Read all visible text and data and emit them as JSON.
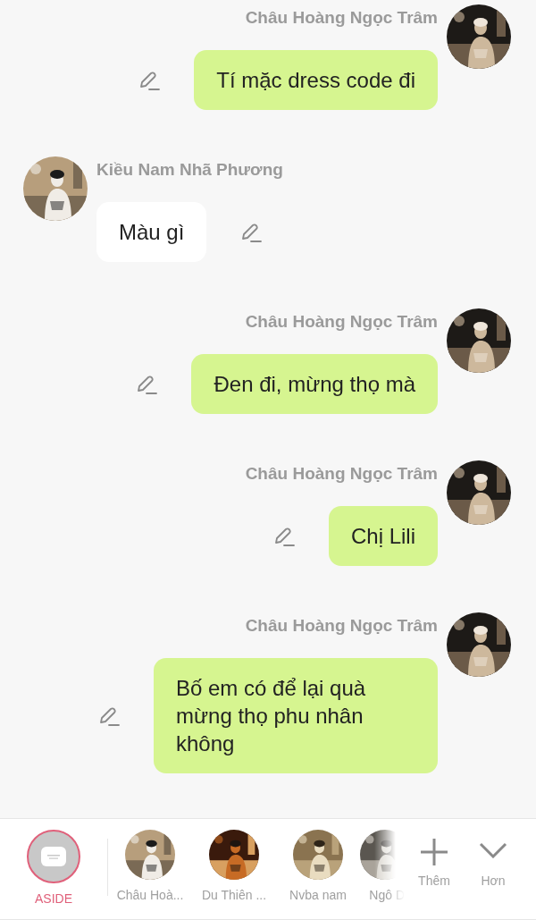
{
  "messages": [
    {
      "outgoing": true,
      "sender": "Châu Hoàng Ngọc Trâm",
      "text": "Tí mặc dress code đi"
    },
    {
      "outgoing": false,
      "sender": "Kiều Nam Nhã Phương",
      "text": "Màu gì"
    },
    {
      "outgoing": true,
      "sender": "Châu Hoàng Ngọc Trâm",
      "text": "Đen đi, mừng thọ mà"
    },
    {
      "outgoing": true,
      "sender": "Châu Hoàng Ngọc Trâm",
      "text": "Chị Lili"
    },
    {
      "outgoing": true,
      "sender": "Châu Hoàng Ngọc Trâm",
      "text": "Bố em có để lại quà mừng thọ phu nhân không"
    }
  ],
  "bottom_bar": [
    {
      "kind": "aside",
      "label": "ASIDE",
      "selected": true
    },
    {
      "kind": "contact",
      "label": "Châu Hoà..."
    },
    {
      "kind": "contact",
      "label": "Du Thiên ..."
    },
    {
      "kind": "contact",
      "label": "Nvba nam"
    },
    {
      "kind": "contact",
      "label": "Ngô D",
      "faded": true
    },
    {
      "kind": "add",
      "label": "Thêm"
    },
    {
      "kind": "more",
      "label": "Hơn"
    }
  ]
}
